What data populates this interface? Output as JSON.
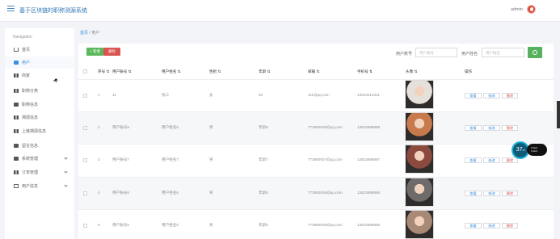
{
  "header": {
    "title": "基于区块链的职称测源系统",
    "user": "admin"
  },
  "sidebar": {
    "title": "Navigation",
    "items": [
      {
        "label": "首页",
        "icon": "home-icon"
      },
      {
        "label": "用户",
        "icon": "doc-icon",
        "active": true
      },
      {
        "label": "商家",
        "icon": "grid-icon"
      },
      {
        "label": "职称分类",
        "icon": "grid-icon"
      },
      {
        "label": "职称信息",
        "icon": "box-icon"
      },
      {
        "label": "溯源信息",
        "icon": "grid-icon"
      },
      {
        "label": "上链溯源信息",
        "icon": "grid-icon"
      },
      {
        "label": "留言信息",
        "icon": "monitor-icon"
      },
      {
        "label": "系统管理",
        "icon": "system-icon",
        "chevron": true
      },
      {
        "label": "订单管理",
        "icon": "grid-icon",
        "chevron": true
      },
      {
        "label": "用户信息",
        "icon": "card-icon",
        "chevron": true
      }
    ]
  },
  "breadcrumb": {
    "home": "首页",
    "current": "用户"
  },
  "toolbar": {
    "add": "+ 新增",
    "delete": "删除"
  },
  "search": {
    "account_label": "用户账号",
    "account_placeholder": "用户账号",
    "name_label": "用户姓名",
    "name_placeholder": "用户姓名"
  },
  "table": {
    "headers": [
      "序号 ⇅",
      "用户账号 ⇅",
      "用户姓名 ⇅",
      "性别 ⇅",
      "年龄 ⇅",
      "邮箱 ⇅",
      "手机号 ⇅",
      "头像 ⇅",
      "操作"
    ],
    "rows": [
      {
        "index": "1",
        "account": "11",
        "name": "张三",
        "gender": "女",
        "age": "20",
        "email": "111@qq.com",
        "phone": "13023212311",
        "avatar_color": "#e6e0da"
      },
      {
        "index": "2",
        "account": "用户账号8",
        "name": "用户姓名8",
        "gender": "男",
        "age": "年龄8",
        "email": "773890008@qq.com",
        "phone": "13823888888",
        "avatar_color": "#c77b4d"
      },
      {
        "index": "3",
        "account": "用户账号7",
        "name": "用户姓名7",
        "gender": "男",
        "age": "年龄7",
        "email": "773890007@qq.com",
        "phone": "13823888887",
        "avatar_color": "#8b4a3d"
      },
      {
        "index": "4",
        "account": "用户账号6",
        "name": "用户姓名6",
        "gender": "男",
        "age": "年龄6",
        "email": "773890006@qq.com",
        "phone": "13823888886",
        "avatar_color": "#6e6b6a"
      },
      {
        "index": "5",
        "account": "用户账号5",
        "name": "用户姓名5",
        "gender": "男",
        "age": "年龄5",
        "email": "773890005@qq.com",
        "phone": "13823888885",
        "avatar_color": "#a78976"
      }
    ],
    "actions": [
      "查看",
      "修改",
      "删除"
    ]
  },
  "widget": {
    "value": "37",
    "unit": "%",
    "text": "0.1k/s\n0.1k/s"
  }
}
